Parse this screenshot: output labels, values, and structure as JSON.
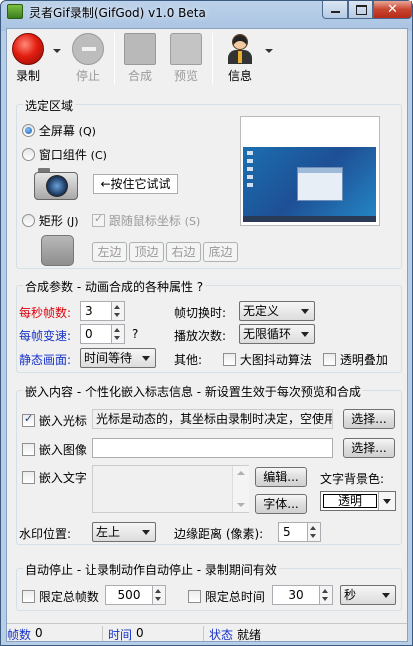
{
  "window": {
    "title": "灵者Gif录制(GifGod) v1.0 Beta",
    "close_glyph": "✕"
  },
  "toolbar": {
    "record": "录制",
    "stop": "停止",
    "compose": "合成",
    "preview": "预览",
    "info": "信息"
  },
  "region": {
    "title": "选定区域",
    "fullscreen": "全屏幕",
    "fullscreen_key": "(Q)",
    "window_component": "窗口组件",
    "window_component_key": "(C)",
    "press_try": "←按住它试试",
    "rectangle": "矩形",
    "rectangle_key": "(J)",
    "follow_mouse": "跟随鼠标坐标",
    "follow_mouse_key": "(S)",
    "left": "左边",
    "top": "顶边",
    "right": "右边",
    "bottom": "底边"
  },
  "compose_params": {
    "title": "合成参数 - 动画合成的各种属性  ?",
    "fps_label": "每秒帧数:",
    "fps_value": "3",
    "speed_label": "每帧变速:",
    "speed_value": "0",
    "speed_help": "?",
    "static_label": "静态画面:",
    "static_value": "时间等待",
    "transition_label": "帧切换时:",
    "transition_value": "无定义",
    "loops_label": "播放次数:",
    "loops_value": "无限循环",
    "other_label": "其他:",
    "anti_shake": "大图抖动算法",
    "transparent_overlay": "透明叠加"
  },
  "embed": {
    "title": "嵌入内容 - 个性化嵌入标志信息 - 新设置生效于每次预览和合成",
    "cursor_label": "嵌入光标",
    "cursor_text": "光标是动态的，其坐标由录制时决定，空使用",
    "image_label": "嵌入图像",
    "image_path": "",
    "text_label": "嵌入文字",
    "text_value": "",
    "select1": "选择...",
    "select2": "选择...",
    "edit": "编辑...",
    "font": "字体...",
    "bg_color_label": "文字背景色:",
    "bg_color_value": "透明",
    "watermark_pos_label": "水印位置:",
    "watermark_pos_value": "左上",
    "margin_label": "边缘距离 (像素):",
    "margin_value": "5"
  },
  "auto_stop": {
    "title": "自动停止 - 让录制动作自动停止 - 录制期间有效",
    "limit_frames_label": "限定总帧数",
    "limit_frames_value": "500",
    "limit_time_label": "限定总时间",
    "limit_time_value": "30",
    "time_unit": "秒"
  },
  "status": {
    "frames_label": "帧数",
    "frames_value": "0",
    "time_label": "时间",
    "time_value": "0",
    "state_label": "状态",
    "state_value": "就绪"
  }
}
